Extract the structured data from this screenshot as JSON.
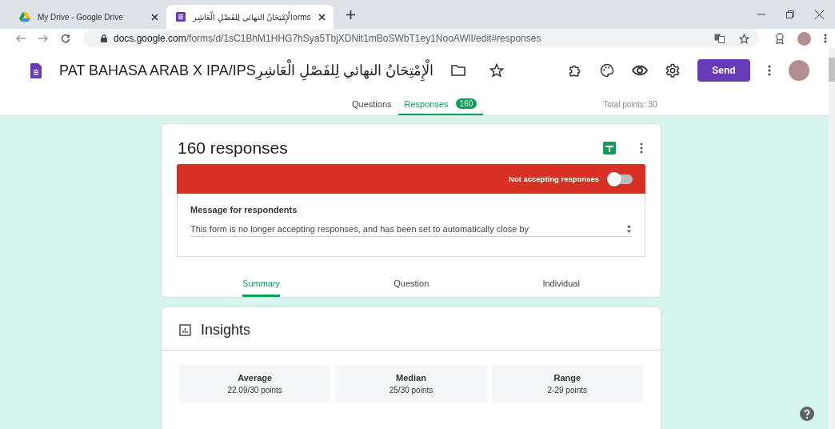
{
  "browser": {
    "tabs": [
      {
        "title": "My Drive - Google Drive",
        "selected": false,
        "kind": "drive"
      },
      {
        "title": "الْإِمْتِحَانُ النهائي لِلفَصْلِ الْعَاشِرorms",
        "selected": true,
        "kind": "forms"
      }
    ],
    "url_host": "docs.google.com",
    "url_path": "/forms/d/1sC1BhM1HHG7hSya5TbjXDNit1mBoSWbT1ey1NooAWlI/edit#responses"
  },
  "form": {
    "title": "PAT BAHASA ARAB X IPA/IPSالْإِمْتِحَانُ النهائي لِلفَصْلِ الْعَاشِرِ",
    "send": "Send",
    "tabs": [
      {
        "label": "Questions",
        "selected": false
      },
      {
        "label": "Responses",
        "badge": "160",
        "selected": true
      }
    ],
    "total_points": "Total points: 30"
  },
  "responses": {
    "heading": "160 responses",
    "accepting_label": "Not accepting responses",
    "accepting": false,
    "message_label": "Message for respondents",
    "message": "This form is no longer accepting responses, and has been set to automatically close by",
    "tabs": [
      {
        "label": "Summary",
        "selected": true
      },
      {
        "label": "Question",
        "selected": false
      },
      {
        "label": "Individual",
        "selected": false
      }
    ]
  },
  "insights": {
    "heading": "Insights",
    "stats": [
      {
        "label": "Average",
        "value": "22.09/30 points"
      },
      {
        "label": "Median",
        "value": "25/30 points"
      },
      {
        "label": "Range",
        "value": "2-29 points"
      }
    ]
  }
}
